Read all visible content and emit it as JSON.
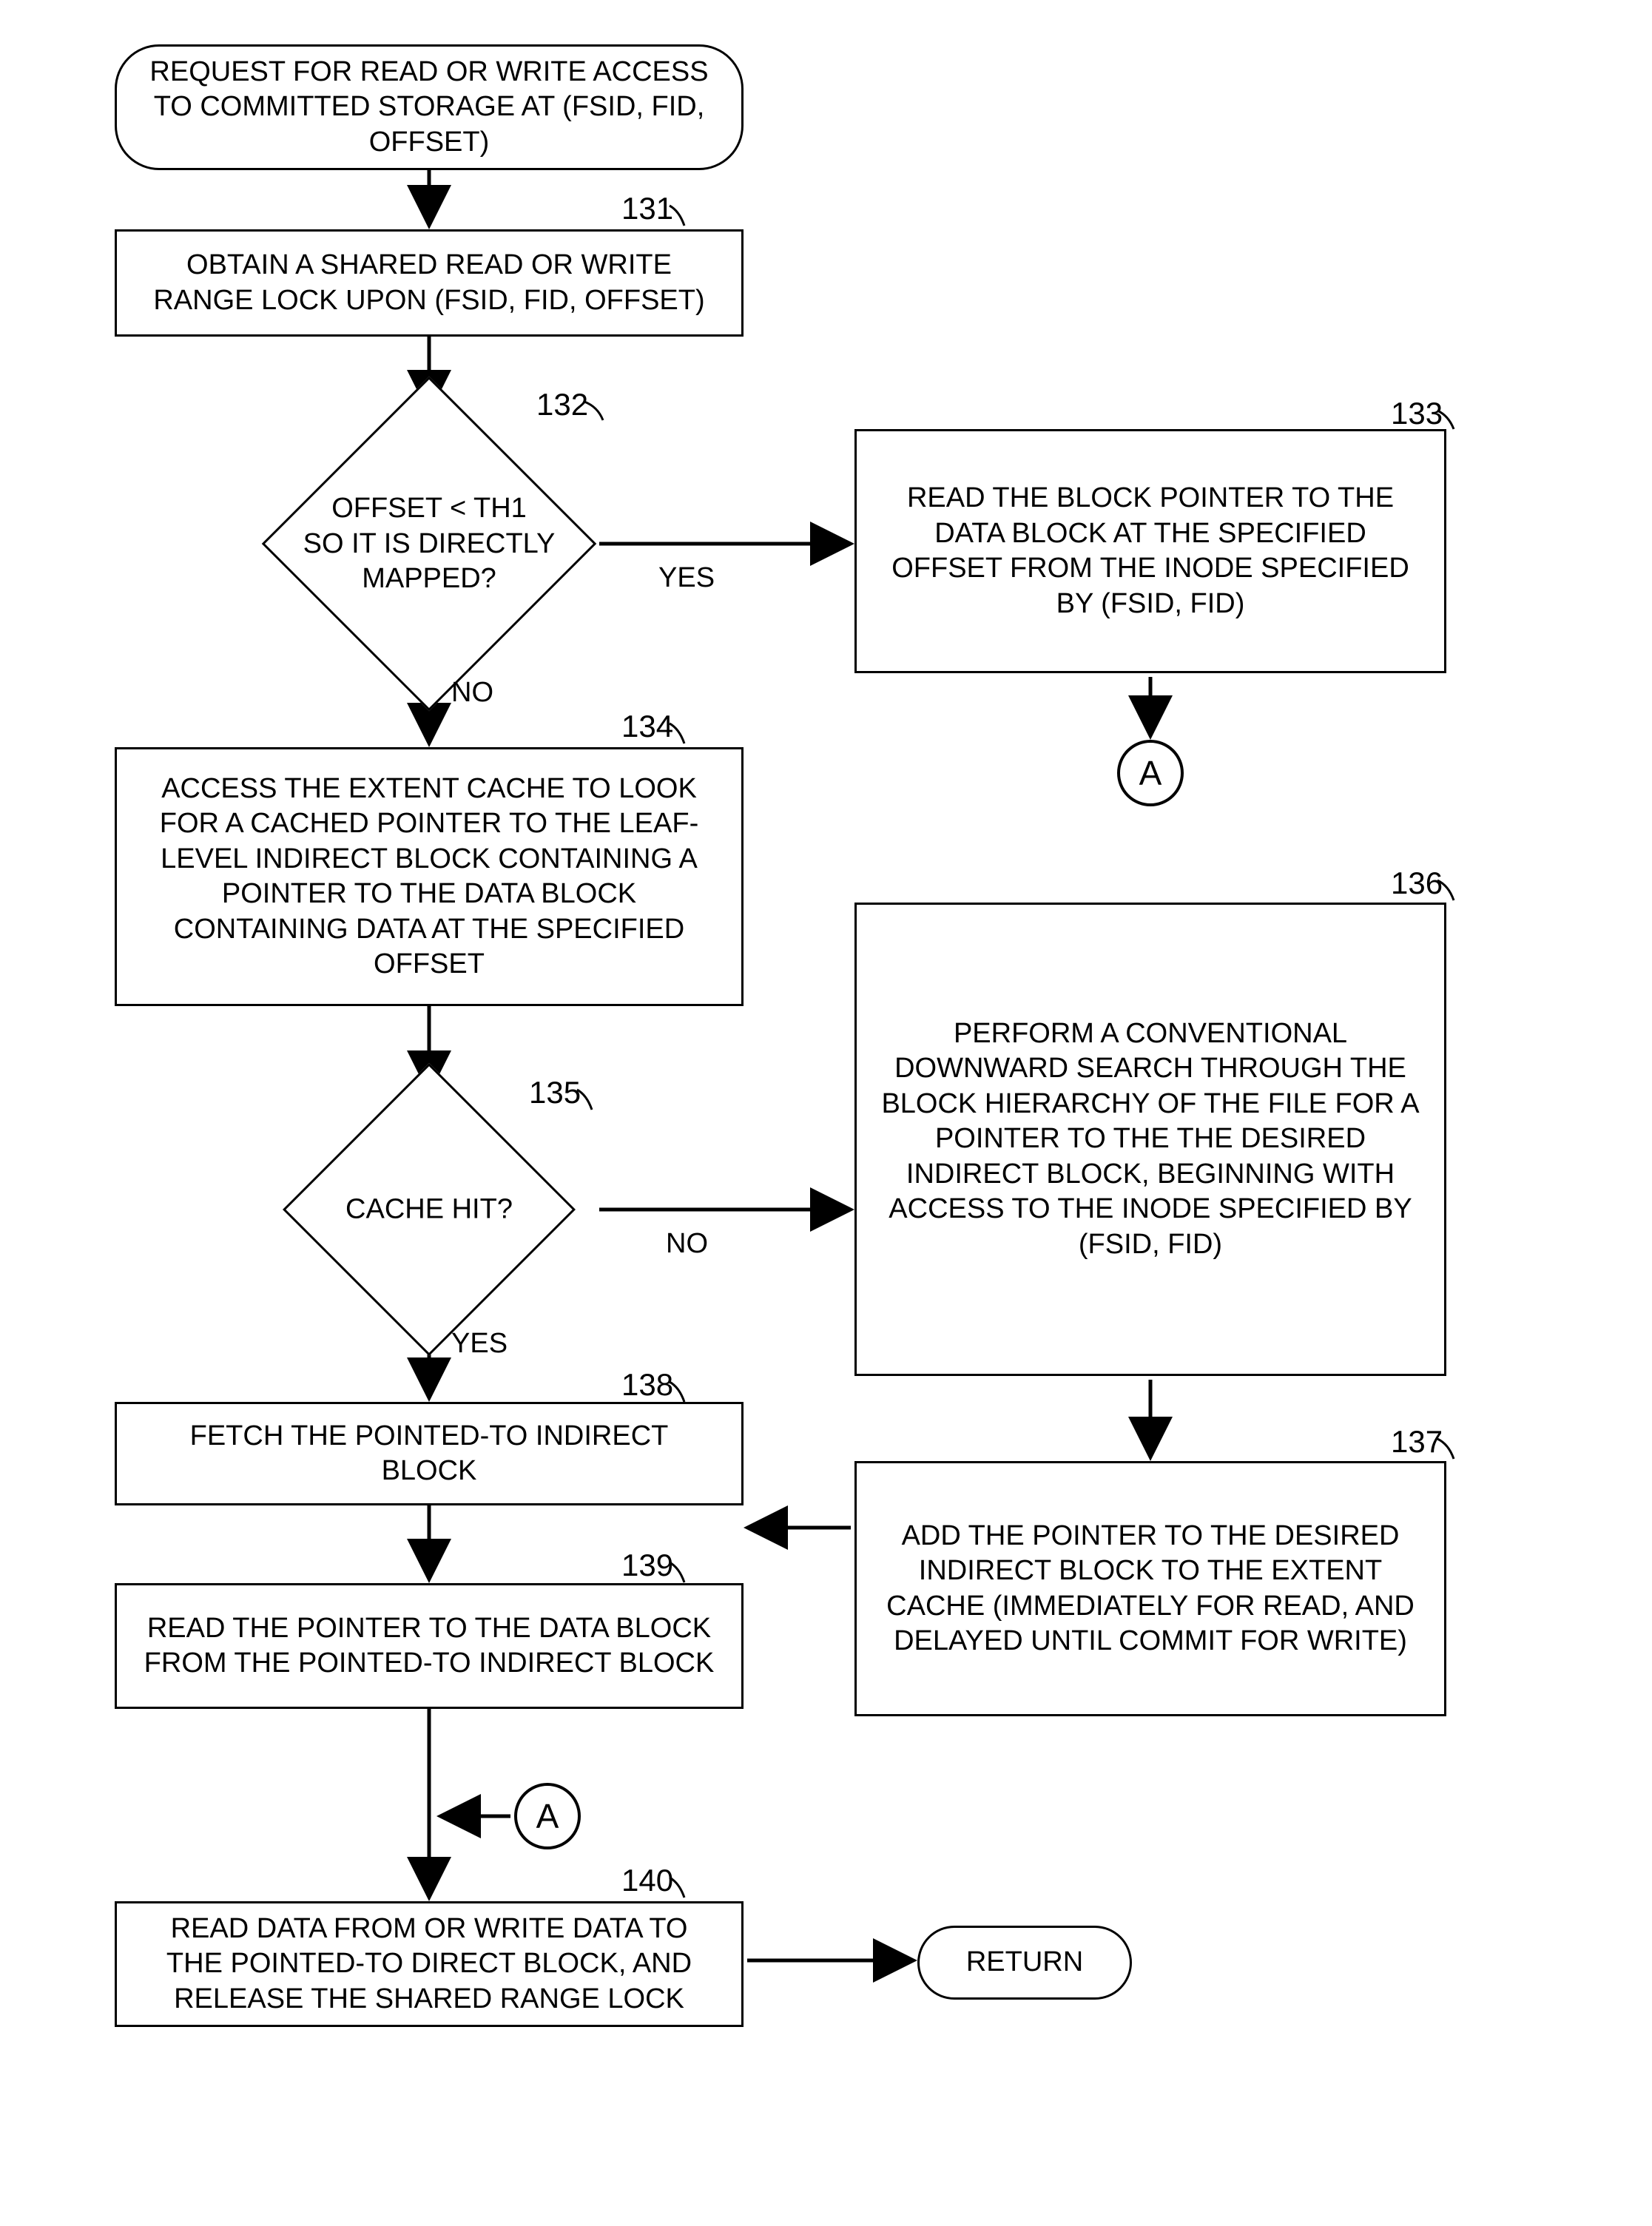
{
  "nodes": {
    "start": "REQUEST FOR READ OR WRITE ACCESS TO COMMITTED STORAGE AT (FSID, FID, OFFSET)",
    "s131": "OBTAIN A SHARED READ OR WRITE RANGE LOCK UPON (FSID, FID, OFFSET)",
    "d132": "OFFSET < TH1\nSO IT IS DIRECTLY\nMAPPED?",
    "s133": "READ THE BLOCK POINTER TO THE DATA BLOCK AT THE SPECIFIED OFFSET FROM THE INODE SPECIFIED BY (FSID, FID)",
    "s134": "ACCESS THE EXTENT CACHE TO LOOK FOR A CACHED POINTER TO THE LEAF-LEVEL INDIRECT BLOCK CONTAINING A POINTER TO THE DATA BLOCK CONTAINING DATA AT THE SPECIFIED OFFSET",
    "d135": "CACHE HIT?",
    "s136": "PERFORM A CONVENTIONAL DOWNWARD SEARCH THROUGH THE BLOCK HIERARCHY OF THE FILE FOR A POINTER TO THE THE DESIRED INDIRECT BLOCK, BEGINNING WITH ACCESS TO THE INODE SPECIFIED BY (FSID, FID)",
    "s137": "ADD THE POINTER TO THE DESIRED INDIRECT BLOCK TO THE EXTENT CACHE (IMMEDIATELY FOR READ, AND DELAYED UNTIL COMMIT FOR WRITE)",
    "s138": "FETCH THE POINTED-TO INDIRECT BLOCK",
    "s139": "READ THE POINTER TO THE DATA BLOCK FROM THE POINTED-TO INDIRECT BLOCK",
    "s140": "READ DATA FROM OR WRITE DATA TO THE POINTED-TO DIRECT BLOCK, AND RELEASE THE SHARED RANGE LOCK",
    "return": "RETURN"
  },
  "labels": {
    "yes": "YES",
    "no": "NO"
  },
  "connectors": {
    "a": "A"
  },
  "refs": {
    "r131": "131",
    "r132": "132",
    "r133": "133",
    "r134": "134",
    "r135": "135",
    "r136": "136",
    "r137": "137",
    "r138": "138",
    "r139": "139",
    "r140": "140"
  }
}
